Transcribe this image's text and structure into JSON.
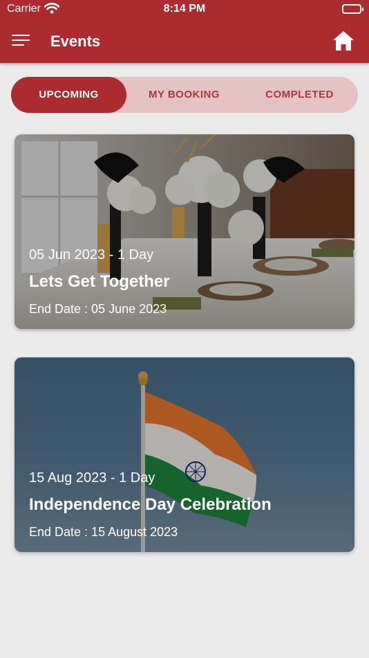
{
  "status_bar": {
    "carrier": "Carrier",
    "time": "8:14 PM"
  },
  "header": {
    "title": "Events",
    "menu_icon": "hamburger-menu-icon",
    "home_icon": "home-icon"
  },
  "tabs": [
    {
      "label": "UPCOMING",
      "active": true
    },
    {
      "label": "MY BOOKING",
      "active": false
    },
    {
      "label": "COMPLETED",
      "active": false
    }
  ],
  "events": [
    {
      "date_line": "05 Jun 2023 - 1 Day",
      "title": "Lets Get Together",
      "end_date": "End Date : 05 June 2023",
      "image": "decorated dining table with flowers and masks"
    },
    {
      "date_line": "15 Aug 2023 - 1 Day",
      "title": "Independence Day Celebration",
      "end_date": "End Date : 15 August 2023",
      "image": "Indian flag waving against blue sky"
    }
  ],
  "colors": {
    "primary": "#ac2b2e",
    "tab_bg": "#e5c3c5",
    "tab_text": "#a8373b",
    "page_bg": "#ebebeb"
  }
}
